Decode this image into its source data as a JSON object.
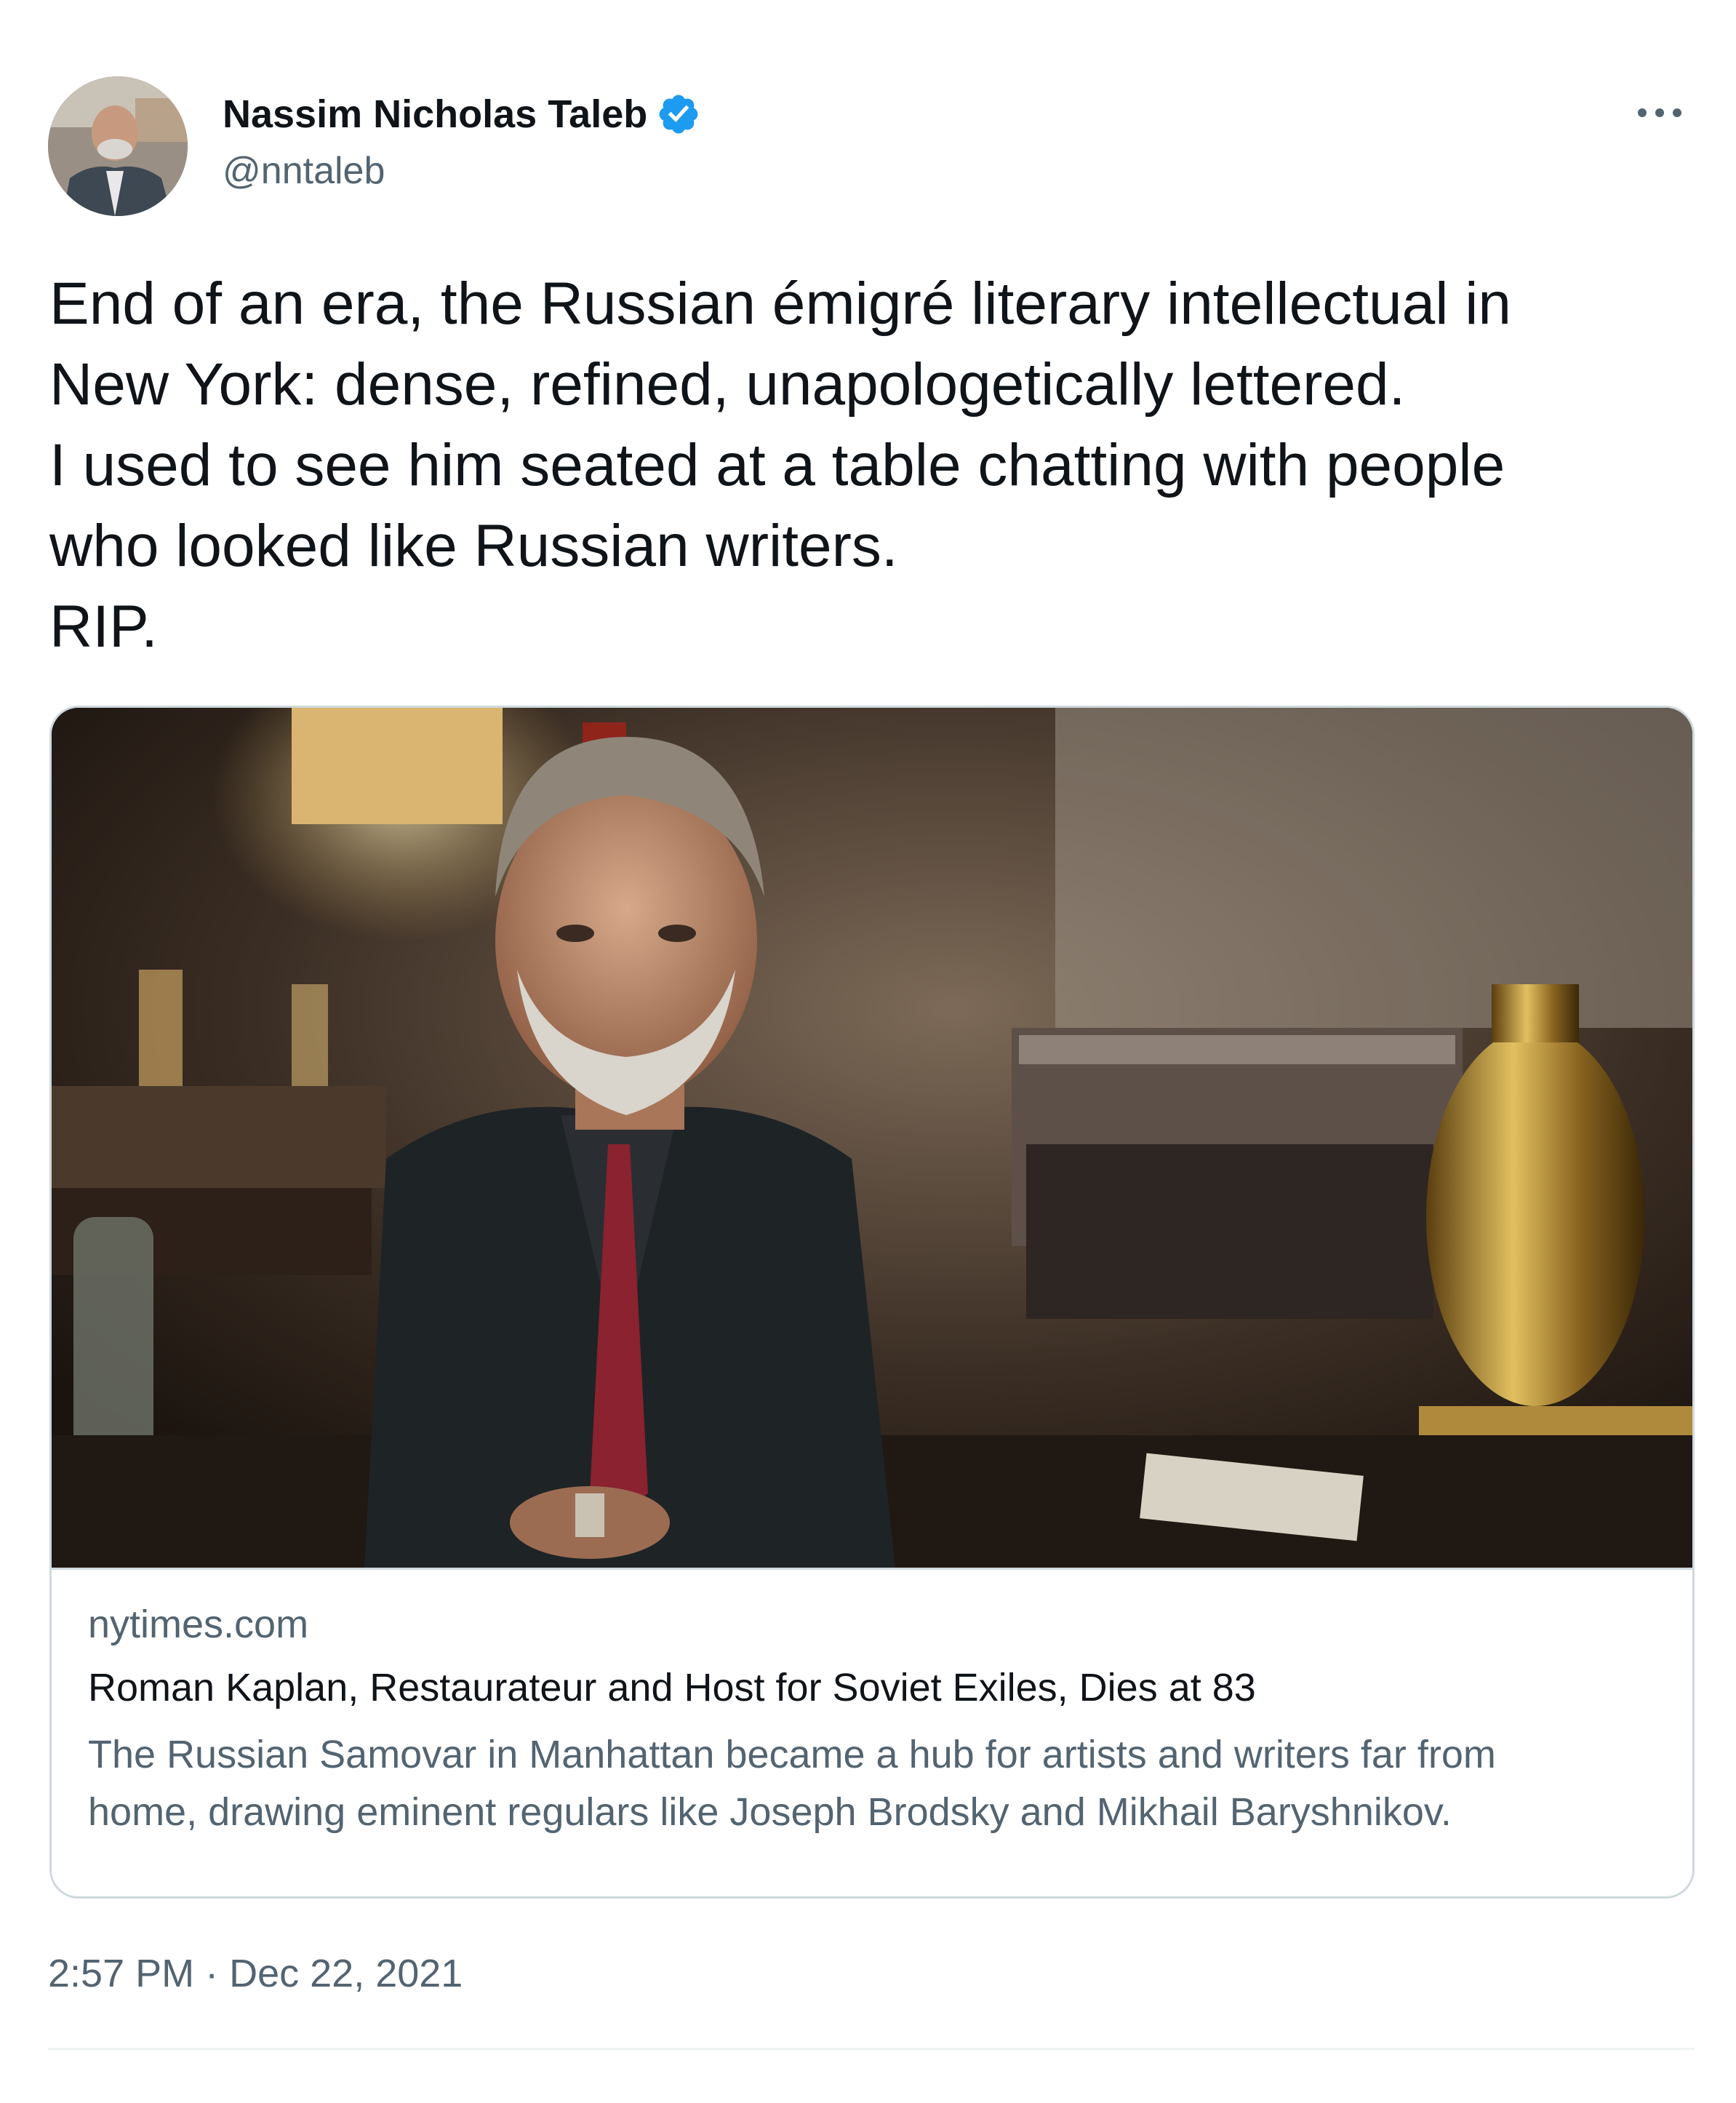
{
  "author": {
    "display_name": "Nassim Nicholas Taleb",
    "handle": "@nntaleb",
    "verified": true,
    "verified_color": "#1d9bf0",
    "avatar_icon": "profile-photo"
  },
  "more_icon": "ellipsis-icon",
  "tweet": {
    "lines": [
      "End of an era, the Russian émigré literary intellectual in",
      "New York: dense, refined, unapologetically lettered.",
      "I used to see him seated at a table chatting with people",
      "who looked like Russian writers.",
      "RIP."
    ]
  },
  "card": {
    "image_description_icon": "article-photo",
    "domain": "nytimes.com",
    "title": "Roman Kaplan, Restaurateur and Host for Soviet Exiles, Dies at 83",
    "description_lines": [
      "The Russian Samovar in Manhattan became a hub for artists and writers far from",
      "home, drawing eminent regulars like Joseph Brodsky and Mikhail Baryshnikov."
    ]
  },
  "timestamp": "2:57 PM · Dec 22, 2021",
  "colors": {
    "text_primary": "#0f1419",
    "text_secondary": "#536471",
    "border": "#cfd9de",
    "divider": "#eff3f4"
  }
}
